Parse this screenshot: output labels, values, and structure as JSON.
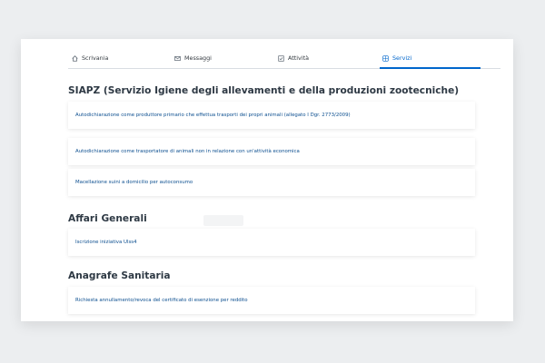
{
  "tabs": [
    {
      "label": "Scrivania",
      "icon": "home-icon"
    },
    {
      "label": "Messaggi",
      "icon": "envelope-icon"
    },
    {
      "label": "Attività",
      "icon": "checklist-icon"
    },
    {
      "label": "Servizi",
      "icon": "grid-icon",
      "active": true
    }
  ],
  "sections": {
    "siapz": {
      "title": "SIAPZ (Servizio Igiene degli allevamenti e della produzioni zootecniche)",
      "items": [
        "Autodichiarazione come produttore primario che effettua trasporti dei propri animali (allegato I Dgr. 2773/2009)",
        "Autodichiarazione come trasportatore di animali non in relazione con un'attività economica",
        "Macellazione suini a domicilio per autoconsumo"
      ]
    },
    "affari": {
      "title": "Affari Generali",
      "items": [
        "Iscrizione iniziativa Ulss4"
      ]
    },
    "anagrafe": {
      "title": "Anagrafe Sanitaria",
      "items": [
        "Richiesta annullamento/revoca del certificato di esenzione per reddito"
      ]
    }
  },
  "colors": {
    "accent": "#0066cc",
    "link": "#0b4e8f",
    "heading": "#2e3944"
  }
}
